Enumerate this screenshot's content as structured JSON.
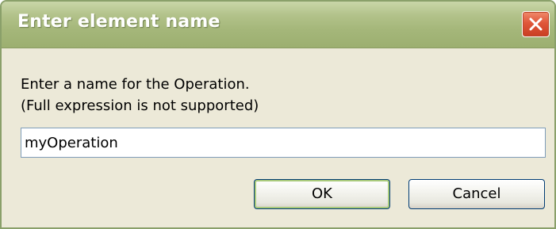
{
  "window": {
    "title": "Enter element name",
    "close_icon": "close-icon"
  },
  "prompt": {
    "line1": "Enter a name for the Operation.",
    "line2": "(Full expression is not supported)"
  },
  "name_input": {
    "value": "myOperation"
  },
  "buttons": {
    "ok_label": "OK",
    "cancel_label": "Cancel"
  },
  "colors": {
    "titlebar": "#a5b77a",
    "close_button": "#e0573a",
    "dialog_background": "#ece9d8",
    "ok_focus_ring": "#a8c97b"
  }
}
